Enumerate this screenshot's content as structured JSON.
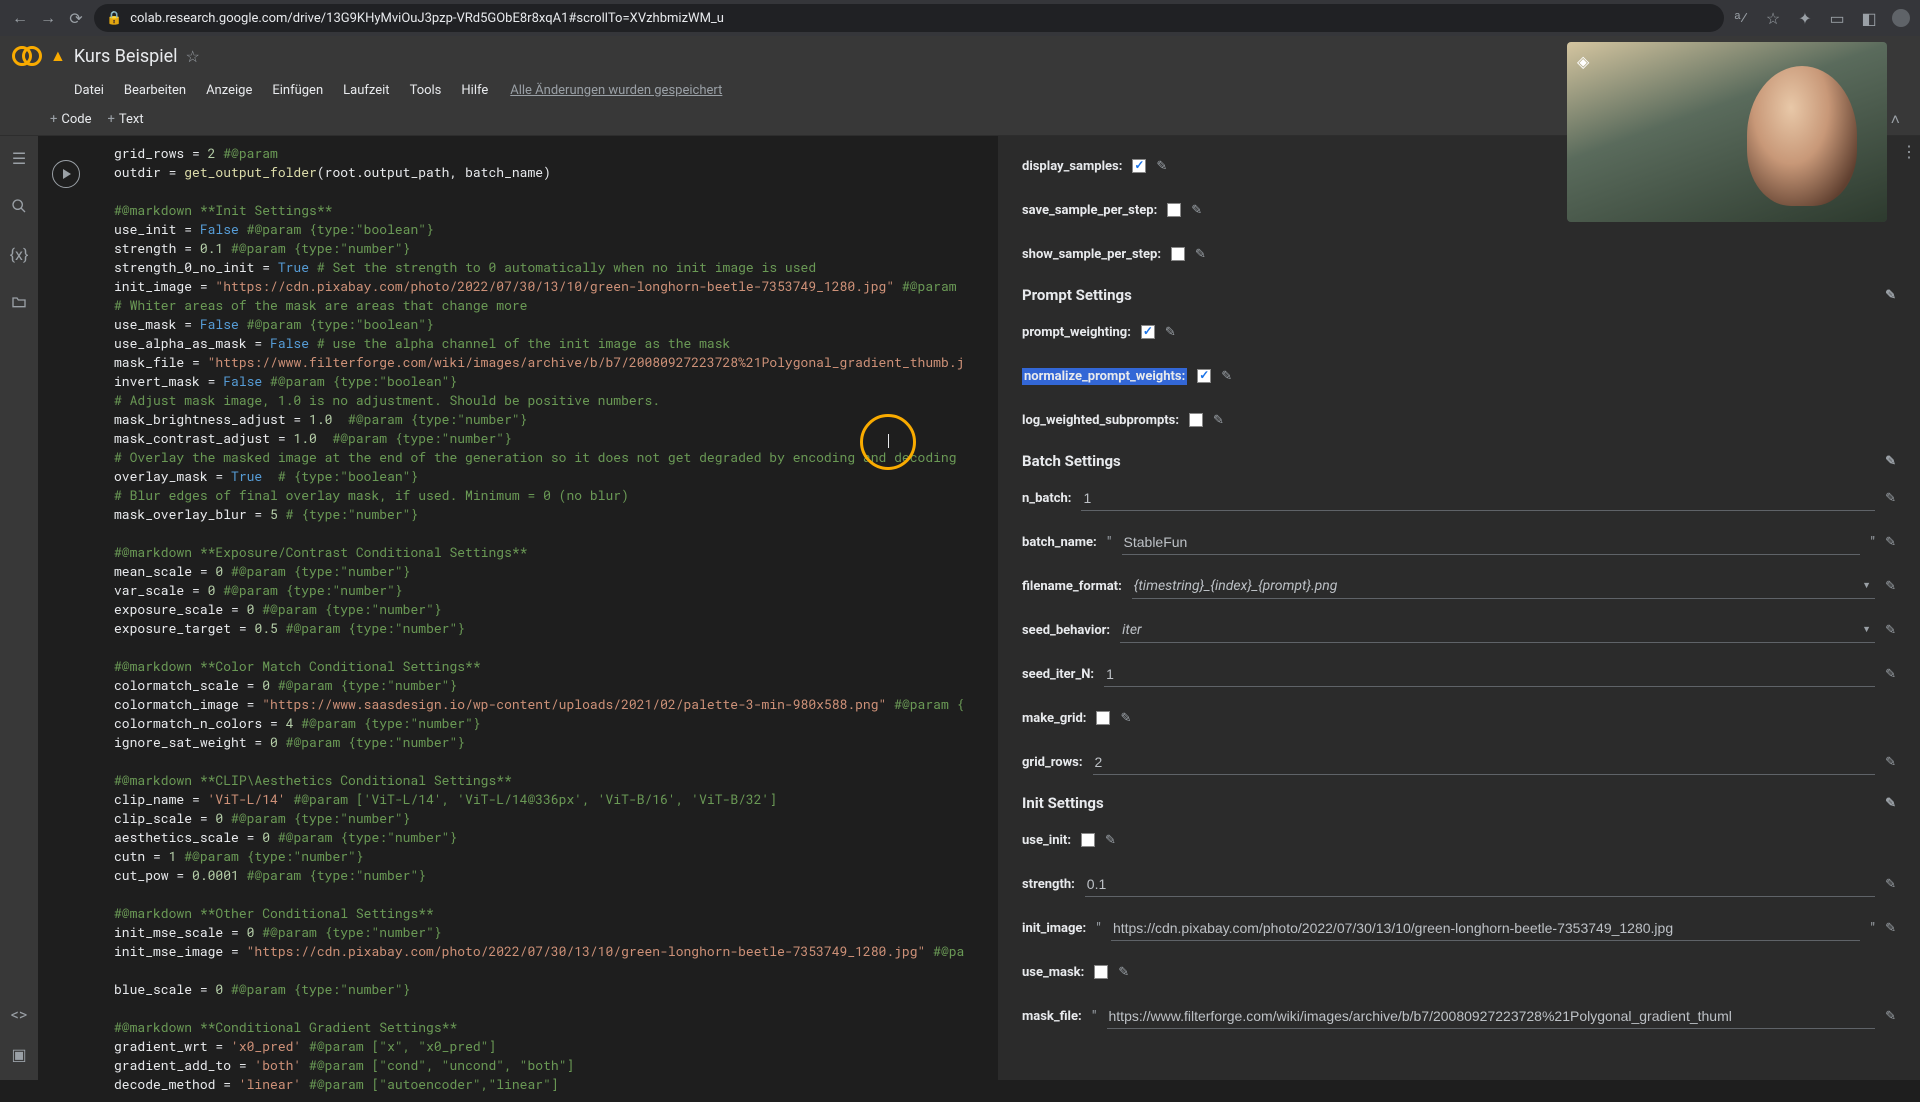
{
  "browser": {
    "url": "colab.research.google.com/drive/13G9KHyMviOuJ3pzp-VRd5GObE8r8xqA1#scrollTo=XVzhbmizWM_u"
  },
  "header": {
    "title": "Kurs Beispiel"
  },
  "menu": {
    "file": "Datei",
    "edit": "Bearbeiten",
    "view": "Anzeige",
    "insert": "Einfügen",
    "runtime": "Laufzeit",
    "tools": "Tools",
    "help": "Hilfe",
    "saved": "Alle Änderungen wurden gespeichert"
  },
  "toolbar": {
    "code": "Code",
    "text": "Text"
  },
  "code": {
    "l1a": "grid_rows = ",
    "l1b": "2",
    "l1c": " #@param",
    "l2a": "outdir = ",
    "l2b": "get_output_folder",
    "l2c": "(root.output_path, batch_name)",
    "l3": "",
    "l4": "#@markdown **Init Settings**",
    "l5a": "use_init = ",
    "l5b": "False",
    "l5c": " #@param {type:\"boolean\"}",
    "l6a": "strength = ",
    "l6b": "0.1",
    "l6c": " #@param {type:\"number\"}",
    "l7a": "strength_0_no_init = ",
    "l7b": "True",
    "l7c": " # Set the strength to 0 automatically when no init image is used",
    "l8a": "init_image = ",
    "l8b": "\"https://cdn.pixabay.com/photo/2022/07/30/13/10/green-longhorn-beetle-7353749_1280.jpg\"",
    "l8c": " #@param",
    "l9": "# Whiter areas of the mask are areas that change more",
    "l10a": "use_mask = ",
    "l10b": "False",
    "l10c": " #@param {type:\"boolean\"}",
    "l11a": "use_alpha_as_mask = ",
    "l11b": "False",
    "l11c": " # use the alpha channel of the init image as the mask",
    "l12a": "mask_file = ",
    "l12b": "\"https://www.filterforge.com/wiki/images/archive/b/b7/20080927223728%21Polygonal_gradient_thumb.j",
    "l13a": "invert_mask = ",
    "l13b": "False",
    "l13c": " #@param {type:\"boolean\"}",
    "l14": "# Adjust mask image, 1.0 is no adjustment. Should be positive numbers.",
    "l15a": "mask_brightness_adjust = ",
    "l15b": "1.0",
    "l15c": "  #@param {type:\"number\"}",
    "l16a": "mask_contrast_adjust = ",
    "l16b": "1.0",
    "l16c": "  #@param {type:\"number\"}",
    "l17": "# Overlay the masked image at the end of the generation so it does not get degraded by encoding and decoding",
    "l18a": "overlay_mask = ",
    "l18b": "True",
    "l18c": "  # {type:\"boolean\"}",
    "l19": "# Blur edges of final overlay mask, if used. Minimum = 0 (no blur)",
    "l20a": "mask_overlay_blur = ",
    "l20b": "5",
    "l20c": " # {type:\"number\"}",
    "l21": "",
    "l22": "#@markdown **Exposure/Contrast Conditional Settings**",
    "l23a": "mean_scale = ",
    "l23b": "0",
    "l23c": " #@param {type:\"number\"}",
    "l24a": "var_scale = ",
    "l24b": "0",
    "l24c": " #@param {type:\"number\"}",
    "l25a": "exposure_scale = ",
    "l25b": "0",
    "l25c": " #@param {type:\"number\"}",
    "l26a": "exposure_target = ",
    "l26b": "0.5",
    "l26c": " #@param {type:\"number\"}",
    "l27": "",
    "l28": "#@markdown **Color Match Conditional Settings**",
    "l29a": "colormatch_scale = ",
    "l29b": "0",
    "l29c": " #@param {type:\"number\"}",
    "l30a": "colormatch_image = ",
    "l30b": "\"https://www.saasdesign.io/wp-content/uploads/2021/02/palette-3-min-980x588.png\"",
    "l30c": " #@param {",
    "l31a": "colormatch_n_colors = ",
    "l31b": "4",
    "l31c": " #@param {type:\"number\"}",
    "l32a": "ignore_sat_weight = ",
    "l32b": "0",
    "l32c": " #@param {type:\"number\"}",
    "l33": "",
    "l34": "#@markdown **CLIP\\Aesthetics Conditional Settings**",
    "l35a": "clip_name = ",
    "l35b": "'ViT-L/14'",
    "l35c": " #@param ['ViT-L/14', 'ViT-L/14@336px', 'ViT-B/16', 'ViT-B/32']",
    "l36a": "clip_scale = ",
    "l36b": "0",
    "l36c": " #@param {type:\"number\"}",
    "l37a": "aesthetics_scale = ",
    "l37b": "0",
    "l37c": " #@param {type:\"number\"}",
    "l38a": "cutn = ",
    "l38b": "1",
    "l38c": " #@param {type:\"number\"}",
    "l39a": "cut_pow = ",
    "l39b": "0.0001",
    "l39c": " #@param {type:\"number\"}",
    "l40": "",
    "l41": "#@markdown **Other Conditional Settings**",
    "l42a": "init_mse_scale = ",
    "l42b": "0",
    "l42c": " #@param {type:\"number\"}",
    "l43a": "init_mse_image = ",
    "l43b": "\"https://cdn.pixabay.com/photo/2022/07/30/13/10/green-longhorn-beetle-7353749_1280.jpg\"",
    "l43c": " #@pa",
    "l44": "",
    "l45a": "blue_scale = ",
    "l45b": "0",
    "l45c": " #@param {type:\"number\"}",
    "l46": "",
    "l47": "#@markdown **Conditional Gradient Settings**",
    "l48a": "gradient_wrt = ",
    "l48b": "'x0_pred'",
    "l48c": " #@param [\"x\", \"x0_pred\"]",
    "l49a": "gradient_add_to = ",
    "l49b": "'both'",
    "l49c": " #@param [\"cond\", \"uncond\", \"both\"]",
    "l50a": "decode_method = ",
    "l50b": "'linear'",
    "l50c": " #@param [\"autoencoder\",\"linear\"]"
  },
  "form": {
    "display_samples": {
      "label": "display_samples:",
      "checked": true
    },
    "save_sample_per_step": {
      "label": "save_sample_per_step:",
      "checked": false
    },
    "show_sample_per_step": {
      "label": "show_sample_per_step:",
      "checked": false
    },
    "prompt_settings_head": "Prompt Settings",
    "prompt_weighting": {
      "label": "prompt_weighting:",
      "checked": true
    },
    "normalize_prompt_weights": {
      "label": "normalize_prompt_weights:",
      "checked": true
    },
    "log_weighted_subprompts": {
      "label": "log_weighted_subprompts:",
      "checked": false
    },
    "batch_settings_head": "Batch Settings",
    "n_batch": {
      "label": "n_batch:",
      "value": "1"
    },
    "batch_name": {
      "label": "batch_name:",
      "value": "StableFun"
    },
    "filename_format": {
      "label": "filename_format:",
      "value": "{timestring}_{index}_{prompt}.png"
    },
    "seed_behavior": {
      "label": "seed_behavior:",
      "value": "iter"
    },
    "seed_iter_N": {
      "label": "seed_iter_N:",
      "value": "1"
    },
    "make_grid": {
      "label": "make_grid:",
      "checked": false
    },
    "grid_rows": {
      "label": "grid_rows:",
      "value": "2"
    },
    "init_settings_head": "Init Settings",
    "use_init": {
      "label": "use_init:",
      "checked": false
    },
    "strength": {
      "label": "strength:",
      "value": "0.1"
    },
    "init_image": {
      "label": "init_image:",
      "value": "https://cdn.pixabay.com/photo/2022/07/30/13/10/green-longhorn-beetle-7353749_1280.jpg"
    },
    "use_mask": {
      "label": "use_mask:",
      "checked": false
    },
    "mask_file": {
      "label": "mask_file:",
      "value": "https://www.filterforge.com/wiki/images/archive/b/b7/20080927223728%21Polygonal_gradient_thuml"
    }
  }
}
